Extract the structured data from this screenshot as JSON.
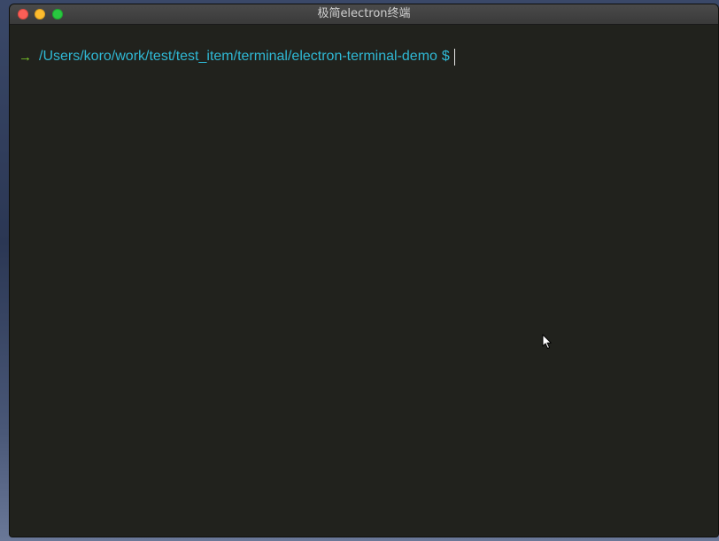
{
  "window": {
    "title": "极简electron终端"
  },
  "terminal": {
    "prompt_arrow": "→",
    "cwd": "/Users/koro/work/test/test_item/terminal/electron-terminal-demo",
    "prompt_symbol": "$",
    "input_text": ""
  },
  "colors": {
    "background": "#21221d",
    "prompt_arrow": "#7ecf2a",
    "path": "#2fb8d4",
    "cursor": "#e8e8e8"
  },
  "icons": {
    "close": "close-dot",
    "minimize": "minimize-dot",
    "zoom": "zoom-dot",
    "mouse": "mouse-pointer-icon"
  }
}
